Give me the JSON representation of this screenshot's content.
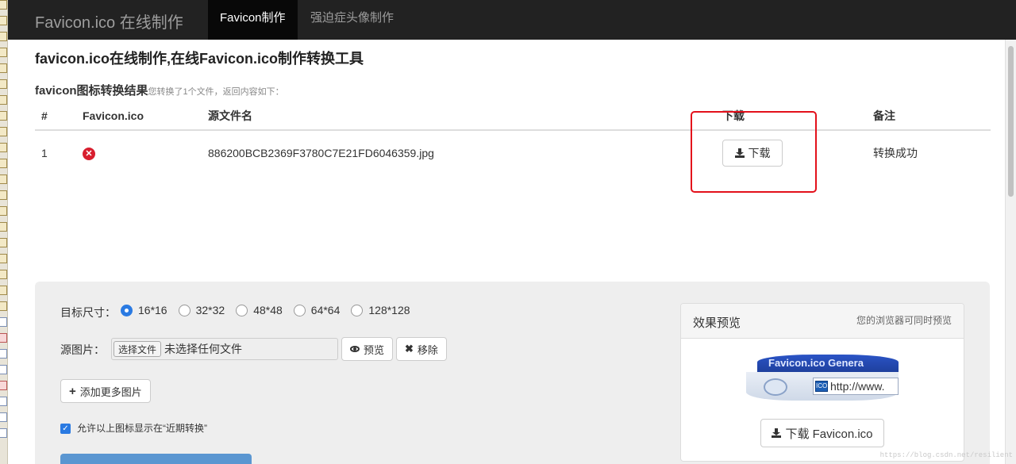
{
  "nav": {
    "brand": "Favicon.ico 在线制作",
    "tabs": [
      {
        "label": "Favicon制作",
        "active": true
      },
      {
        "label": "强迫症头像制作",
        "active": false
      }
    ]
  },
  "main": {
    "page_title": "favicon.ico在线制作,在线Favicon.ico制作转换工具",
    "result_title": "favicon图标转换结果",
    "result_note": "您转换了1个文件，返回内容如下：",
    "table": {
      "headers": [
        "#",
        "Favicon.ico",
        "源文件名",
        "下载",
        "备注"
      ],
      "rows": [
        {
          "num": "1",
          "icon": "favicon-preview-icon",
          "filename": "886200BCB2369F3780C7E21FD6046359.jpg",
          "download_label": "下载",
          "note": "转换成功"
        }
      ]
    }
  },
  "form": {
    "size_label": "目标尺寸：",
    "sizes": [
      {
        "label": "16*16",
        "selected": true
      },
      {
        "label": "32*32",
        "selected": false
      },
      {
        "label": "48*48",
        "selected": false
      },
      {
        "label": "64*64",
        "selected": false
      },
      {
        "label": "128*128",
        "selected": false
      }
    ],
    "source_label": "源图片：",
    "file_button": "选择文件",
    "file_status": "未选择任何文件",
    "preview_button": "预览",
    "remove_button": "移除",
    "add_more_button": "添加更多图片",
    "checkbox_label": "允许以上图标显示在“近期转换”",
    "checkbox_checked": true
  },
  "preview": {
    "title": "效果预览",
    "subtitle": "您的浏览器可同时预览",
    "art_title": "Favicon.ico Genera",
    "art_url": "http://www.",
    "art_icon": "ICO",
    "download_button": "下载 Favicon.ico"
  },
  "watermark": "https://blog.csdn.net/resilient",
  "colors": {
    "accent": "#2a7ae2",
    "highlight": "#e3101b",
    "navbar": "#222222"
  }
}
